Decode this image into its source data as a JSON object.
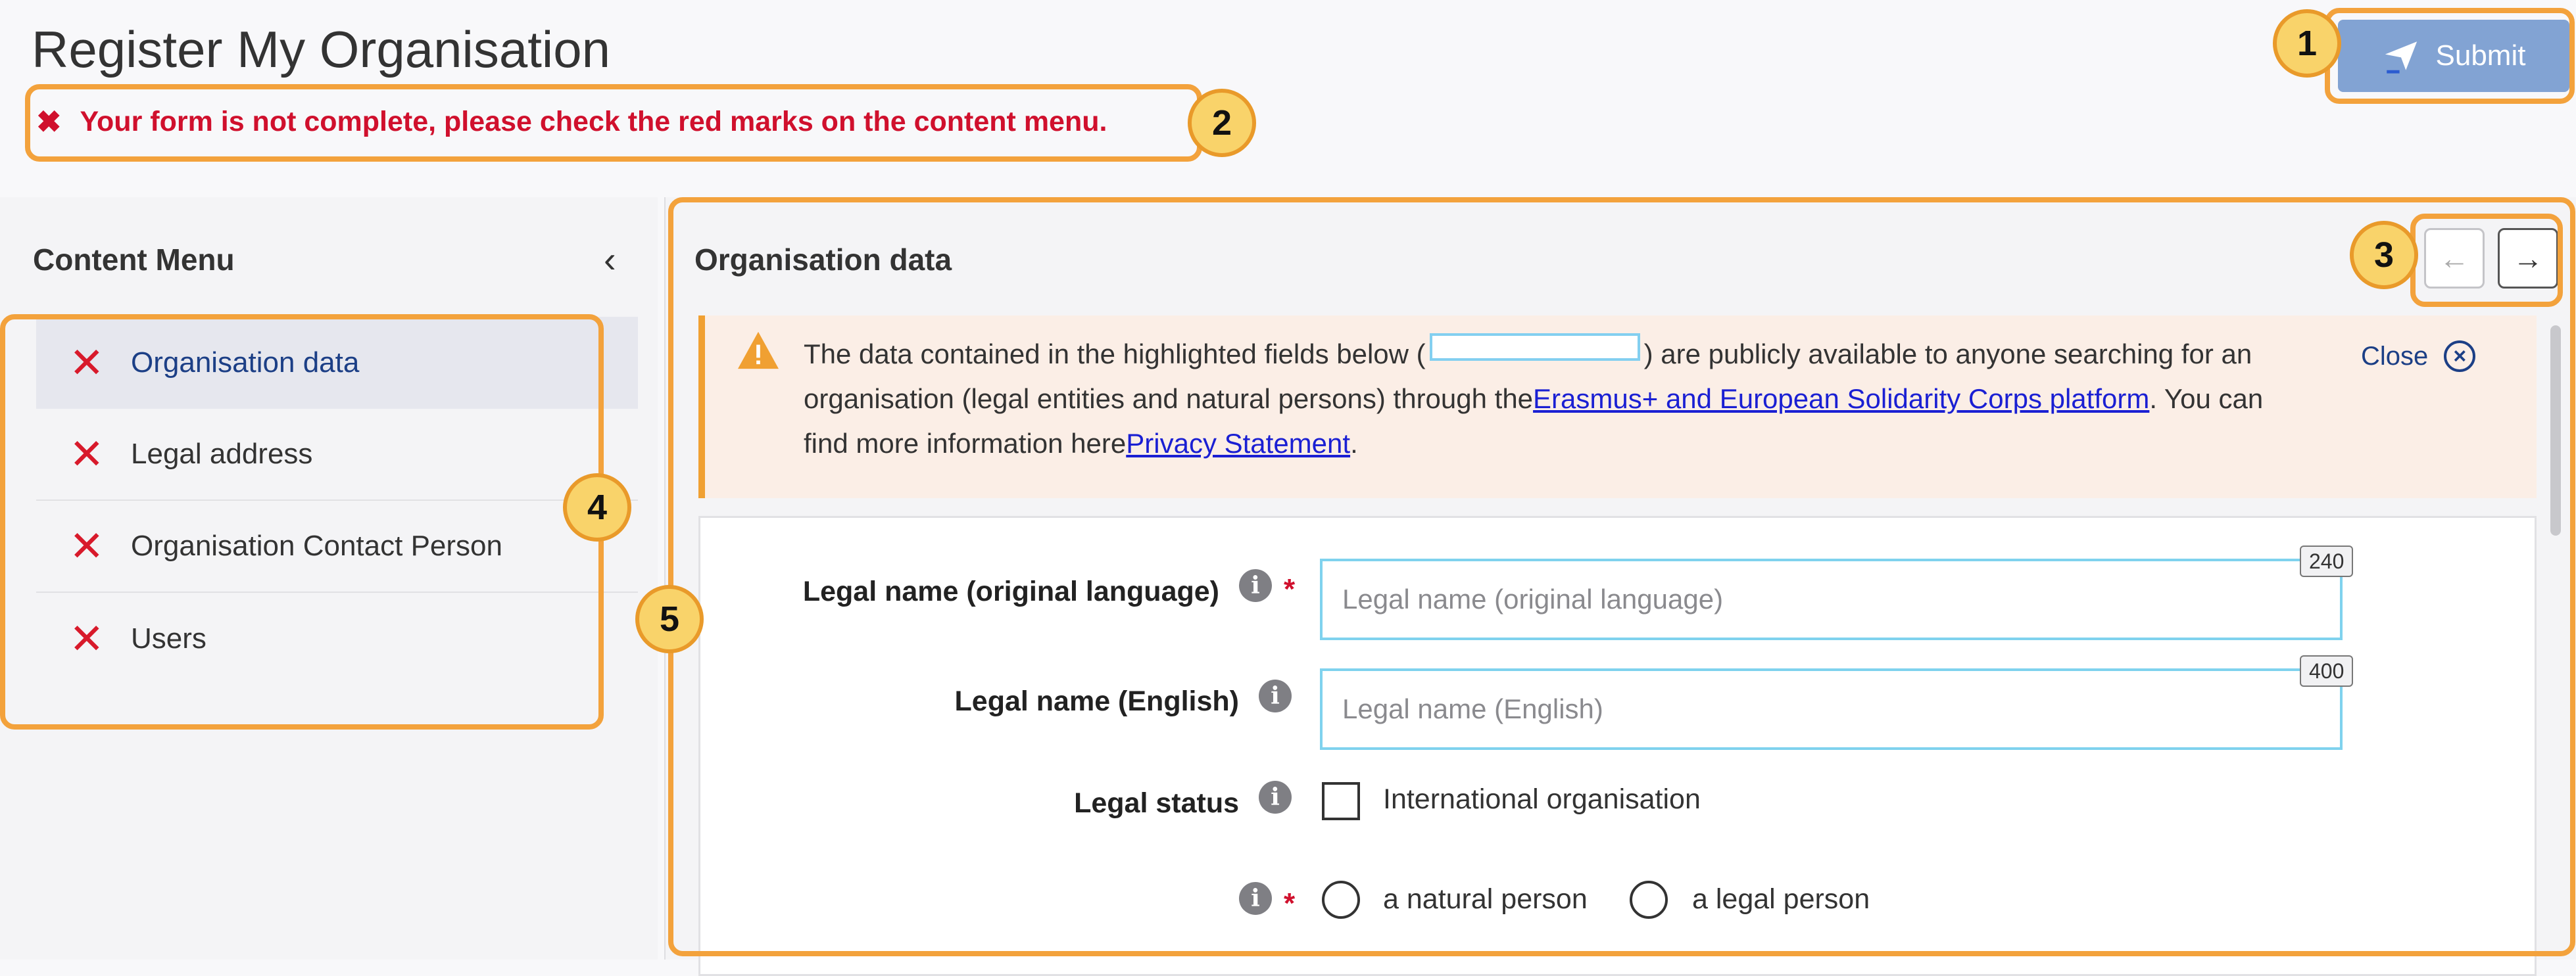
{
  "header": {
    "title": "Register My Organisation",
    "error_message": "Your form is not complete, please check the red marks on the content menu.",
    "submit_label": "Submit"
  },
  "callouts": [
    "1",
    "2",
    "3",
    "4",
    "5"
  ],
  "sidebar": {
    "title": "Content Menu",
    "items": [
      {
        "label": "Organisation data",
        "status": "error",
        "active": true
      },
      {
        "label": "Legal address",
        "status": "error"
      },
      {
        "label": "Organisation Contact Person",
        "status": "error"
      },
      {
        "label": "Users",
        "status": "error"
      }
    ]
  },
  "main": {
    "section_title": "Organisation data",
    "notice": {
      "text_before": "The data contained in the highlighted fields below (",
      "text_after": ") are publicly available to anyone searching for an organisation (legal entities and natural persons) through the",
      "link1": "Erasmus+ and European Solidarity Corps platform",
      "text_mid": ". You can find more information here",
      "link2": "Privacy Statement",
      "text_end": ".",
      "close_label": "Close"
    },
    "fields": {
      "legal_name_original": {
        "label": "Legal name (original language)",
        "placeholder": "Legal name (original language)",
        "counter": "240"
      },
      "legal_name_english": {
        "label": "Legal name (English)",
        "placeholder": "Legal name (English)",
        "counter": "400"
      },
      "legal_status": {
        "label": "Legal status",
        "checkbox_label": "International organisation"
      },
      "person_type": {
        "option1": "a natural person",
        "option2": "a legal person"
      }
    }
  },
  "colors": {
    "error": "#d0102d",
    "accent": "#82a3d3",
    "callout": "#f3a23c"
  }
}
